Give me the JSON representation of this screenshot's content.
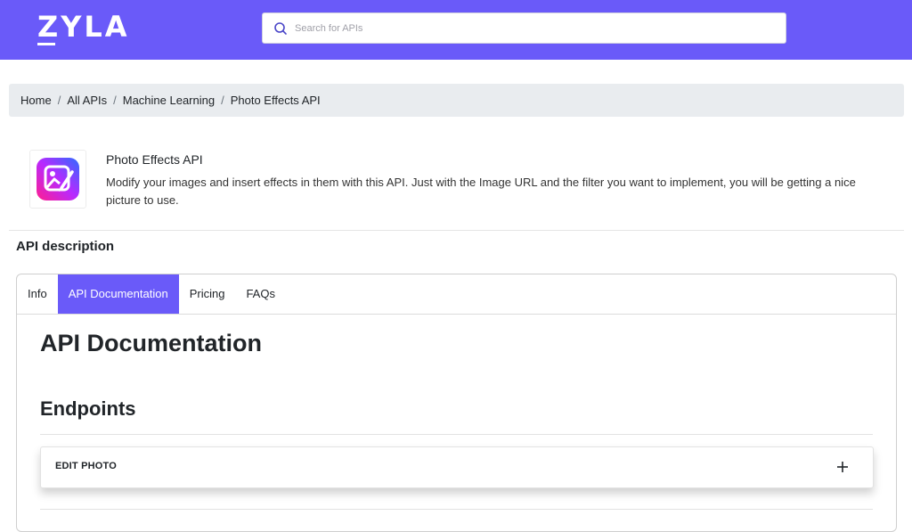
{
  "header": {
    "logo_text": "ZYLA",
    "search_placeholder": "Search for APIs",
    "search_value": "",
    "accent_color": "#6a5af9"
  },
  "breadcrumb": {
    "items": [
      "Home",
      "All APIs",
      "Machine Learning",
      "Photo Effects API"
    ],
    "separator": "/"
  },
  "api": {
    "title": "Photo Effects API",
    "description": "Modify your images and insert effects in them with this API. Just with the Image URL and the filter you want to implement, you will be getting a nice picture to use.",
    "icon": "photo-edit-icon"
  },
  "section": {
    "title": "API description"
  },
  "tabs": [
    {
      "label": "Info",
      "active": false
    },
    {
      "label": "API Documentation",
      "active": true
    },
    {
      "label": "Pricing",
      "active": false
    },
    {
      "label": "FAQs",
      "active": false
    }
  ],
  "documentation": {
    "title": "API Documentation",
    "endpoints_title": "Endpoints",
    "endpoints": [
      {
        "label": "EDIT PHOTO",
        "icon": "plus-icon"
      }
    ]
  }
}
